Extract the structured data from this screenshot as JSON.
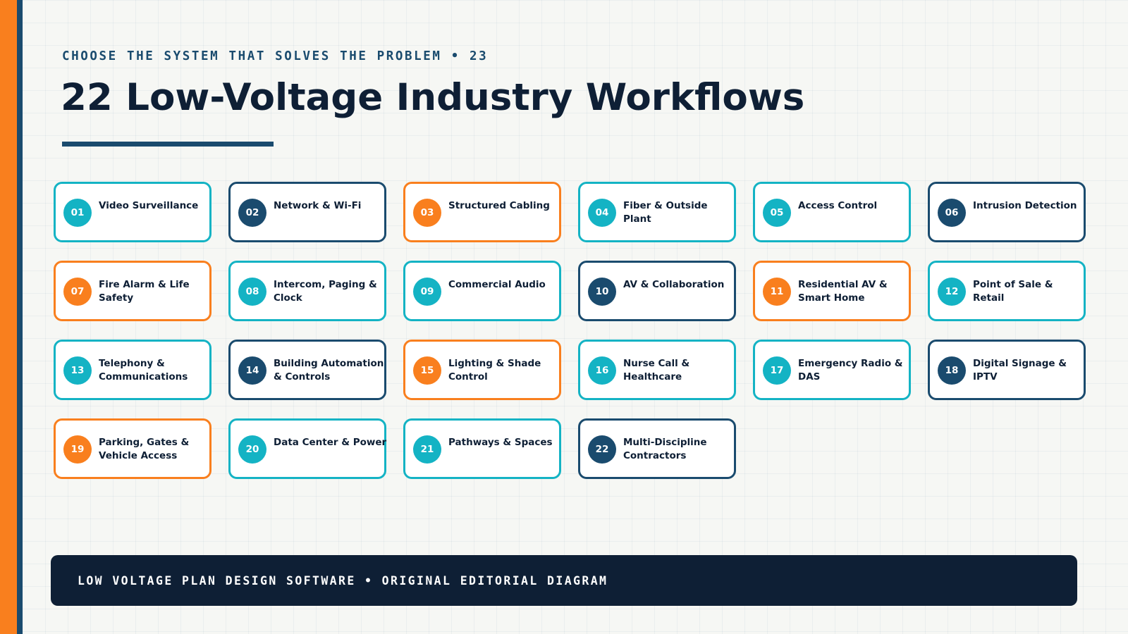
{
  "header": {
    "eyebrow": "CHOOSE THE SYSTEM THAT SOLVES THE PROBLEM • 23",
    "title": "22 Low-Voltage Industry Workflows"
  },
  "colors": {
    "teal": "#14b3c4",
    "navy": "#1a4b6e",
    "orange": "#f97f1e",
    "dark": "#0e1f35",
    "background": "#f6f7f4"
  },
  "workflows": [
    {
      "number": "01",
      "label": "Video Surveillance",
      "color": "teal"
    },
    {
      "number": "02",
      "label": "Network & Wi-Fi",
      "color": "navy"
    },
    {
      "number": "03",
      "label": "Structured Cabling",
      "color": "orange"
    },
    {
      "number": "04",
      "label": "Fiber & Outside Plant",
      "color": "teal"
    },
    {
      "number": "05",
      "label": "Access Control",
      "color": "teal"
    },
    {
      "number": "06",
      "label": "Intrusion Detection",
      "color": "navy"
    },
    {
      "number": "07",
      "label": "Fire Alarm & Life Safety",
      "color": "orange"
    },
    {
      "number": "08",
      "label": "Intercom, Paging & Clock",
      "color": "teal"
    },
    {
      "number": "09",
      "label": "Commercial Audio",
      "color": "teal"
    },
    {
      "number": "10",
      "label": "AV & Collaboration",
      "color": "navy"
    },
    {
      "number": "11",
      "label": "Residential AV & Smart Home",
      "color": "orange"
    },
    {
      "number": "12",
      "label": "Point of Sale & Retail",
      "color": "teal"
    },
    {
      "number": "13",
      "label": "Telephony & Communications",
      "color": "teal"
    },
    {
      "number": "14",
      "label": "Building Automation & Controls",
      "color": "navy"
    },
    {
      "number": "15",
      "label": "Lighting & Shade Control",
      "color": "orange"
    },
    {
      "number": "16",
      "label": "Nurse Call & Healthcare",
      "color": "teal"
    },
    {
      "number": "17",
      "label": "Emergency Radio & DAS",
      "color": "teal"
    },
    {
      "number": "18",
      "label": "Digital Signage & IPTV",
      "color": "navy"
    },
    {
      "number": "19",
      "label": "Parking, Gates & Vehicle Access",
      "color": "orange"
    },
    {
      "number": "20",
      "label": "Data Center & Power",
      "color": "teal"
    },
    {
      "number": "21",
      "label": "Pathways & Spaces",
      "color": "teal"
    },
    {
      "number": "22",
      "label": "Multi-Discipline Contractors",
      "color": "navy"
    }
  ],
  "footer": {
    "text": "LOW VOLTAGE PLAN DESIGN SOFTWARE • ORIGINAL EDITORIAL DIAGRAM"
  }
}
